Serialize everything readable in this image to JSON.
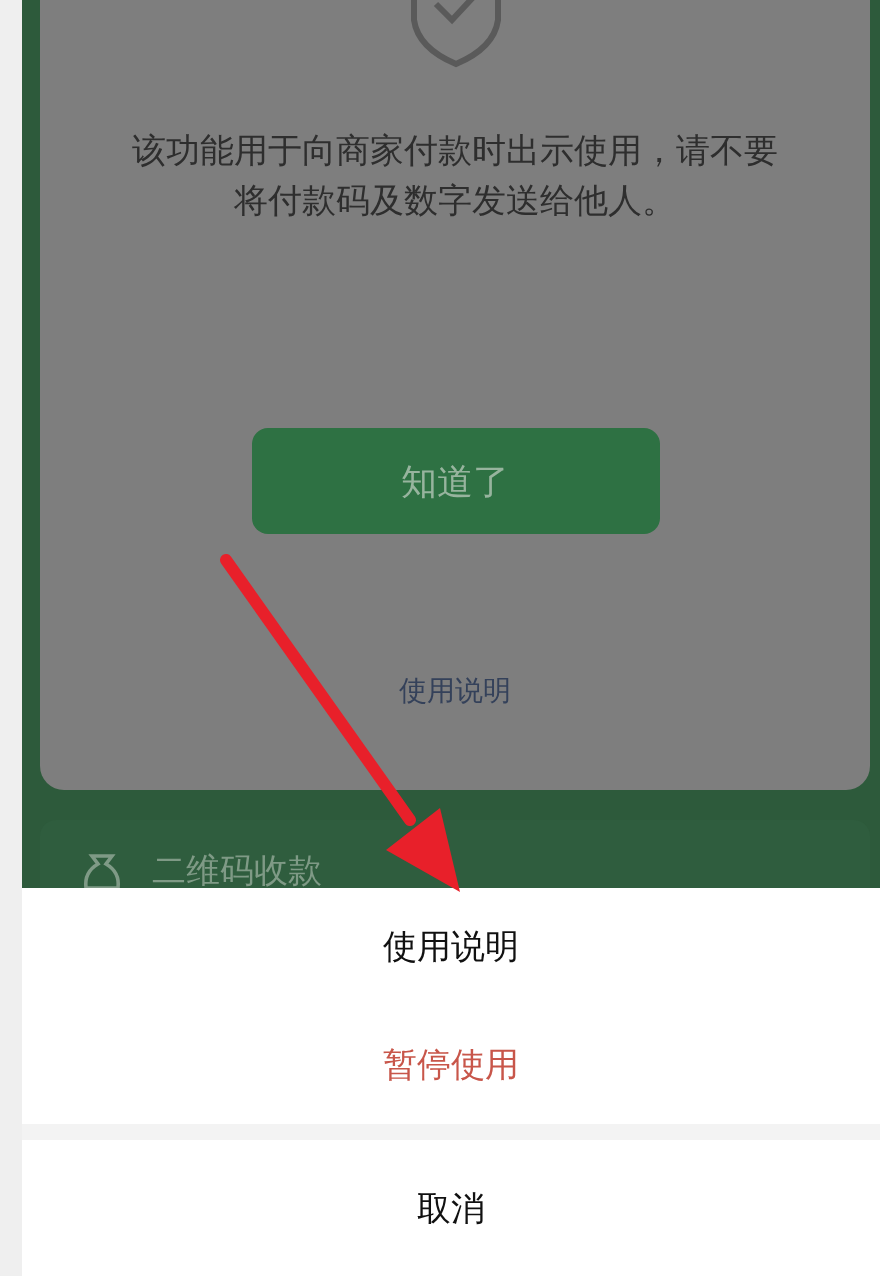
{
  "notice": {
    "message": "该功能用于向商家付款时出示使用，请不要将付款码及数字发送给他人。",
    "confirm_button": "知道了",
    "help_link": "使用说明"
  },
  "list_row": {
    "label": "二维码收款"
  },
  "action_sheet": {
    "actions": [
      {
        "label": "使用说明",
        "kind": "normal"
      },
      {
        "label": "暂停使用",
        "kind": "danger"
      }
    ],
    "cancel": "取消"
  },
  "annotation": {
    "kind": "arrow"
  }
}
